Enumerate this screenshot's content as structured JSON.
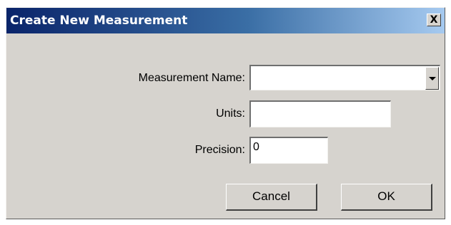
{
  "dialog": {
    "title": "Create New Measurement",
    "close_label": "X"
  },
  "form": {
    "measurement_name": {
      "label": "Measurement Name:",
      "value": ""
    },
    "units": {
      "label": "Units:",
      "value": ""
    },
    "precision": {
      "label": "Precision:",
      "value": "0"
    }
  },
  "buttons": {
    "cancel_label": "Cancel",
    "ok_label": "OK"
  },
  "icons": {
    "dropdown": "chevron-down-icon",
    "close": "close-icon"
  }
}
